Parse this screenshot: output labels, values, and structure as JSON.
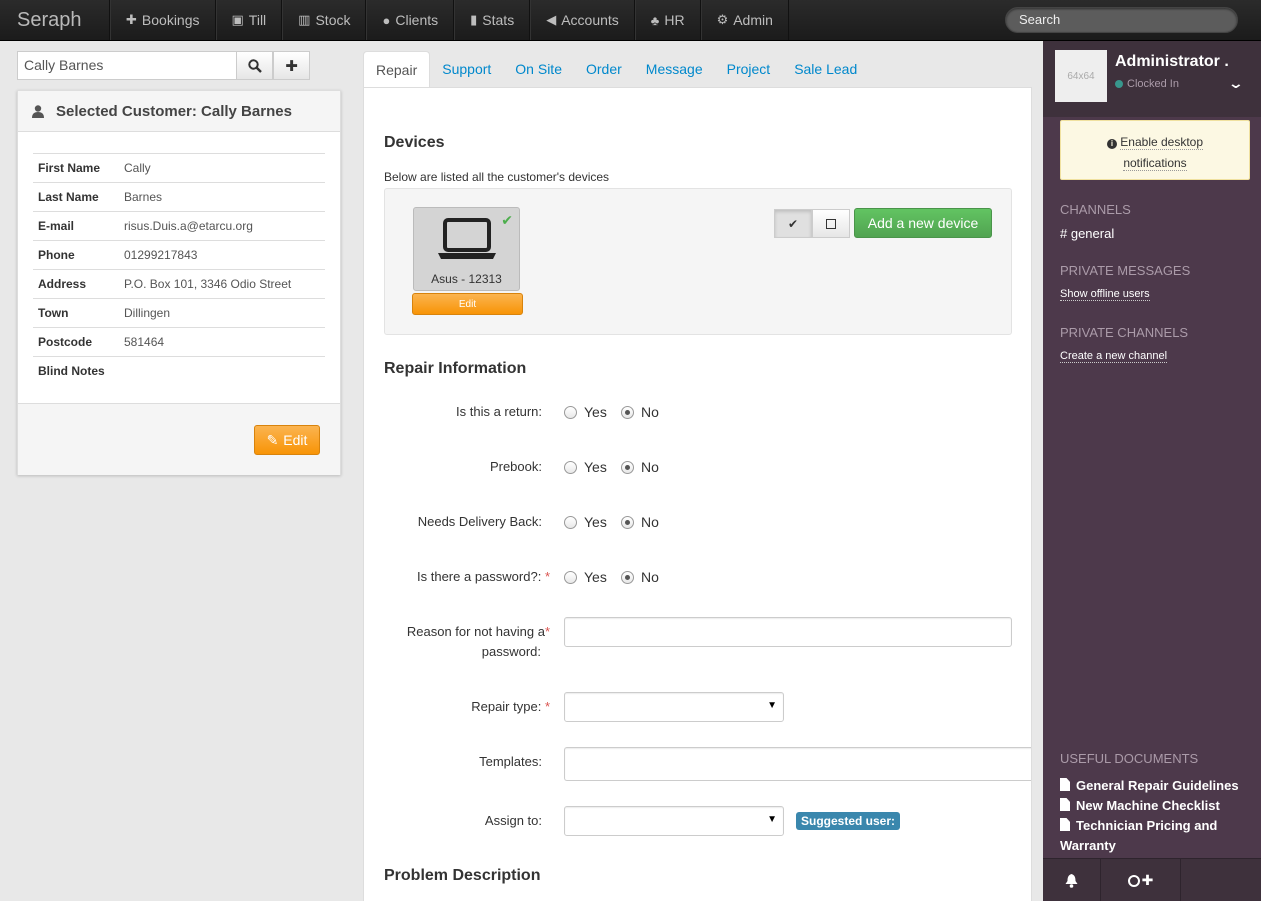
{
  "nav": {
    "brand": "Seraph",
    "items": [
      {
        "icon": "plus-icon",
        "glyph": "✚",
        "label": "Bookings"
      },
      {
        "icon": "camera-icon",
        "glyph": "▣",
        "label": "Till"
      },
      {
        "icon": "barcode-icon",
        "glyph": "▥",
        "label": "Stock"
      },
      {
        "icon": "user-icon",
        "glyph": "●",
        "label": "Clients"
      },
      {
        "icon": "bar-chart-icon",
        "glyph": "▮",
        "label": "Stats"
      },
      {
        "icon": "bullhorn-icon",
        "glyph": "◀",
        "label": "Accounts"
      },
      {
        "icon": "sitemap-icon",
        "glyph": "♣",
        "label": "HR"
      },
      {
        "icon": "cogs-icon",
        "glyph": "⚙",
        "label": "Admin"
      }
    ],
    "search_placeholder": "Search"
  },
  "customer_search": {
    "value": "Cally Barnes"
  },
  "customer": {
    "title": "Selected Customer: Cally Barnes",
    "fields": [
      {
        "label": "First Name",
        "value": "Cally"
      },
      {
        "label": "Last Name",
        "value": "Barnes"
      },
      {
        "label": "E-mail",
        "value": "risus.Duis.a@etarcu.org"
      },
      {
        "label": "Phone",
        "value": "01299217843"
      },
      {
        "label": "Address",
        "value": "P.O. Box 101, 3346 Odio Street"
      },
      {
        "label": "Town",
        "value": "Dillingen"
      },
      {
        "label": "Postcode",
        "value": "581464"
      },
      {
        "label": "Blind Notes",
        "value": ""
      }
    ],
    "edit_label": "Edit"
  },
  "tabs": [
    "Repair",
    "Support",
    "On Site",
    "Order",
    "Message",
    "Project",
    "Sale Lead"
  ],
  "active_tab": "Repair",
  "devices": {
    "heading": "Devices",
    "description": "Below are listed all the customer's devices",
    "items": [
      {
        "name": "Asus - 12313",
        "selected": true,
        "edit_label": "Edit"
      }
    ],
    "add_label": "Add a new device"
  },
  "repair": {
    "heading": "Repair Information",
    "questions": [
      {
        "label": "Is this a return:",
        "required": false,
        "selected": "No"
      },
      {
        "label": "Prebook:",
        "required": false,
        "selected": "No"
      },
      {
        "label": "Needs Delivery Back:",
        "required": false,
        "selected": "No"
      },
      {
        "label": "Is there a password?:",
        "required": true,
        "selected": "No"
      }
    ],
    "yes_label": "Yes",
    "no_label": "No",
    "reason_label_line1": "Reason for not having a",
    "reason_label_line2": "password:",
    "reason_value": "",
    "repair_type_label": "Repair type:",
    "repair_type_value": "",
    "templates_label": "Templates:",
    "templates_value": "",
    "assign_label": "Assign to:",
    "assign_value": "",
    "suggested_label": "Suggested user:",
    "required_marker": "*"
  },
  "problem_heading": "Problem Description",
  "sidebar": {
    "avatar_text": "64x64",
    "user_name": "Administrator .",
    "status": "Clocked In",
    "status_color": "#38978d",
    "notification_line1": "Enable desktop",
    "notification_line2": "notifications",
    "channels_heading": "CHANNELS",
    "channel": "# general",
    "pm_heading": "PRIVATE MESSAGES",
    "pm_link": "Show offline users",
    "pc_heading": "PRIVATE CHANNELS",
    "pc_link": "Create a new channel",
    "docs_heading": "USEFUL DOCUMENTS",
    "docs": [
      "General Repair Guidelines",
      "New Machine Checklist",
      "Technician Pricing and Warranty"
    ]
  }
}
